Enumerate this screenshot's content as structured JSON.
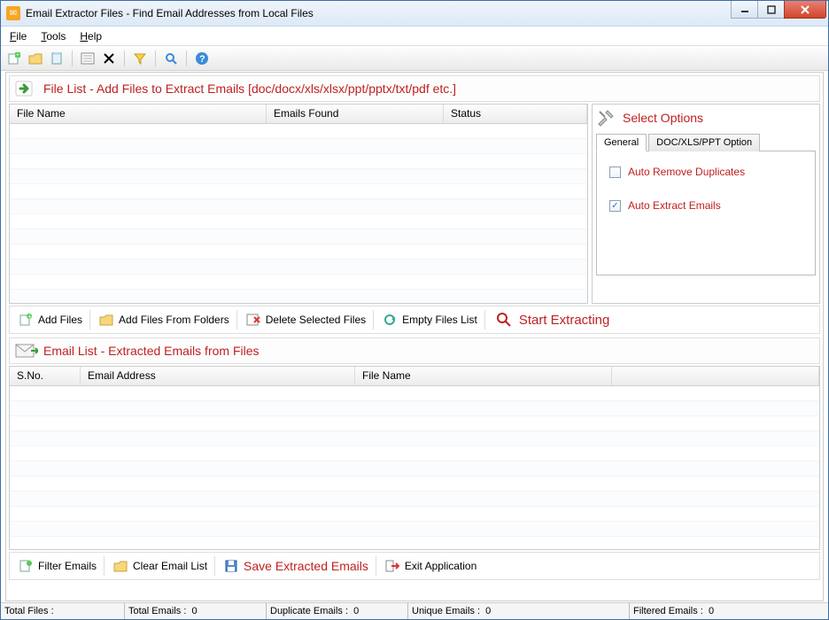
{
  "window": {
    "title": "Email Extractor Files -   Find Email Addresses from Local Files"
  },
  "menu": {
    "file": "File",
    "tools": "Tools",
    "help": "Help"
  },
  "file_list": {
    "heading": "File List - Add Files to Extract Emails [doc/docx/xls/xlsx/ppt/pptx/txt/pdf etc.]",
    "cols": {
      "name": "File Name",
      "found": "Emails Found",
      "status": "Status"
    }
  },
  "options": {
    "heading": "Select Options",
    "tabs": {
      "general": "General",
      "office": "DOC/XLS/PPT Option"
    },
    "auto_remove": "Auto Remove Duplicates",
    "auto_extract": "Auto Extract Emails"
  },
  "actions": {
    "add_files": "Add Files",
    "add_folder": "Add Files From Folders",
    "delete_selected": "Delete Selected Files",
    "empty_list": "Empty Files List",
    "start": "Start Extracting"
  },
  "email_list": {
    "heading": "Email List - Extracted Emails from Files",
    "cols": {
      "sno": "S.No.",
      "email": "Email Address",
      "file": "File Name"
    }
  },
  "actions2": {
    "filter": "Filter Emails",
    "clear": "Clear Email List",
    "save": "Save Extracted Emails",
    "exit": "Exit Application"
  },
  "status": {
    "total_files_label": "Total Files :",
    "total_emails_label": "Total Emails :",
    "total_emails_value": "0",
    "dup_label": "Duplicate Emails :",
    "dup_value": "0",
    "unique_label": "Unique Emails :",
    "unique_value": "0",
    "filtered_label": "Filtered Emails :",
    "filtered_value": "0"
  }
}
